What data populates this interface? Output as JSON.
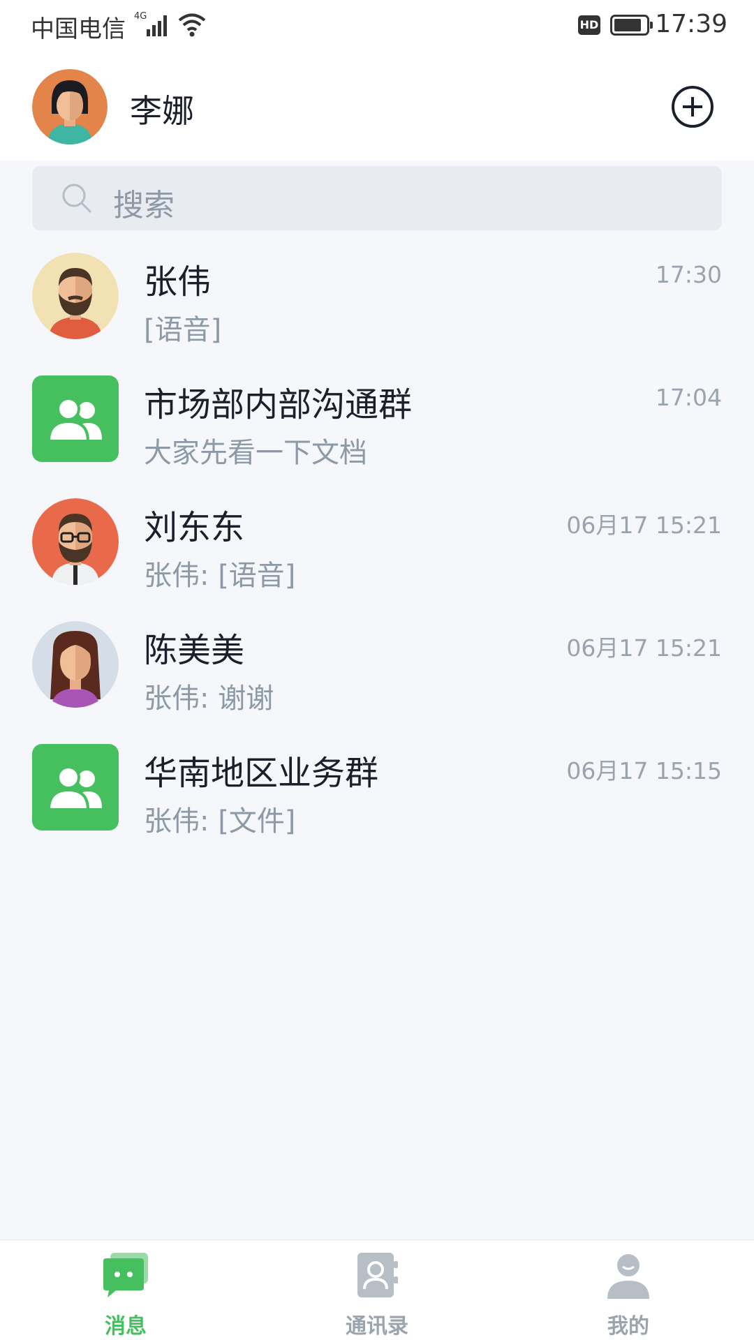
{
  "status_bar": {
    "carrier": "中国电信",
    "network": "4G",
    "hd_badge": "HD",
    "time": "17:39"
  },
  "header": {
    "user_name": "李娜",
    "add_icon": "plus-circle-icon"
  },
  "search": {
    "placeholder": "搜索"
  },
  "conversations": [
    {
      "name": "张伟",
      "preview": "[语音]",
      "time": "17:30",
      "avatar": "bearded-man-avatar"
    },
    {
      "name": "市场部内部沟通群",
      "preview": "大家先看一下文档",
      "time": "17:04",
      "avatar": "group-icon"
    },
    {
      "name": "刘东东",
      "preview": "张伟: [语音]",
      "time": "06月17 15:21",
      "avatar": "glasses-man-avatar"
    },
    {
      "name": "陈美美",
      "preview": "张伟: 谢谢",
      "time": "06月17 15:21",
      "avatar": "long-hair-woman-avatar"
    },
    {
      "name": "华南地区业务群",
      "preview": "张伟: [文件]",
      "time": "06月17 15:15",
      "avatar": "group-icon"
    }
  ],
  "tabs": [
    {
      "label": "消息",
      "icon": "chat-bubbles-icon",
      "active": true
    },
    {
      "label": "通讯录",
      "icon": "contacts-book-icon",
      "active": false
    },
    {
      "label": "我的",
      "icon": "person-icon",
      "active": false
    }
  ],
  "colors": {
    "accent": "#46bf5e",
    "background": "#f5f7fa",
    "muted_text": "#8e99a8"
  }
}
